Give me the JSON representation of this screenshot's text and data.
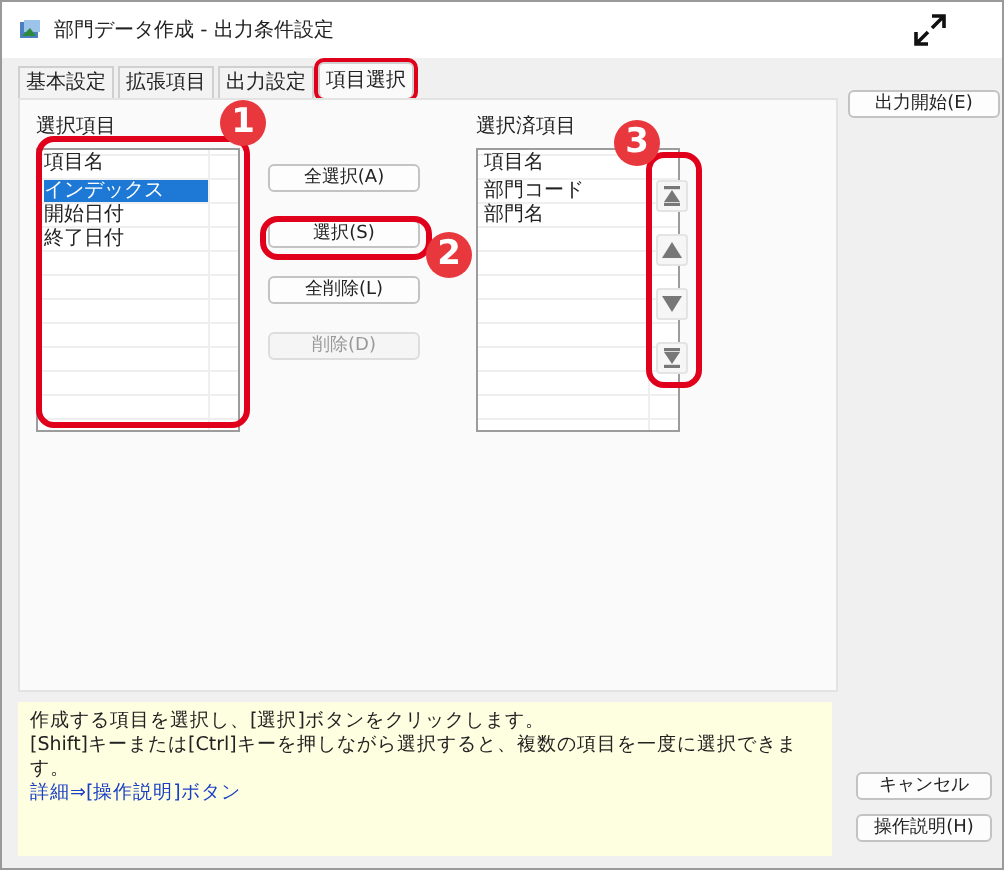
{
  "window": {
    "title": "部門データ作成 - 出力条件設定"
  },
  "tabs": [
    {
      "label": "基本設定",
      "selected": false
    },
    {
      "label": "拡張項目",
      "selected": false
    },
    {
      "label": "出力設定",
      "selected": false
    },
    {
      "label": "項目選択",
      "selected": true
    }
  ],
  "available": {
    "label": "選択項目",
    "header": "項目名",
    "items": [
      {
        "text": "インデックス",
        "selected": true
      },
      {
        "text": "開始日付",
        "selected": false
      },
      {
        "text": "終了日付",
        "selected": false
      }
    ]
  },
  "actions": [
    {
      "label": "全選択(A)",
      "disabled": false
    },
    {
      "label": "選択(S)",
      "disabled": false
    },
    {
      "label": "全削除(L)",
      "disabled": false
    },
    {
      "label": "削除(D)",
      "disabled": true
    }
  ],
  "chosen": {
    "label": "選択済項目",
    "header": "項目名",
    "items": [
      {
        "text": "部門コード",
        "selected": false
      },
      {
        "text": "部門名",
        "selected": false
      }
    ]
  },
  "order_buttons": [
    {
      "kind": "top"
    },
    {
      "kind": "up"
    },
    {
      "kind": "down"
    },
    {
      "kind": "bottom"
    }
  ],
  "start_button": "出力開始(E)",
  "hint": {
    "lines": [
      "作成する項目を選択し、[選択]ボタンをクリックします。",
      "[Shift]キーまたは[Ctrl]キーを押しながら選択すると、複数の項目を一度に選択できます。"
    ],
    "link": "詳細⇒[操作説明]ボタン"
  },
  "bottom_buttons": [
    "キャンセル",
    "操作説明(H)"
  ],
  "callouts": [
    {
      "number": "1"
    },
    {
      "number": "2"
    },
    {
      "number": "3"
    }
  ]
}
